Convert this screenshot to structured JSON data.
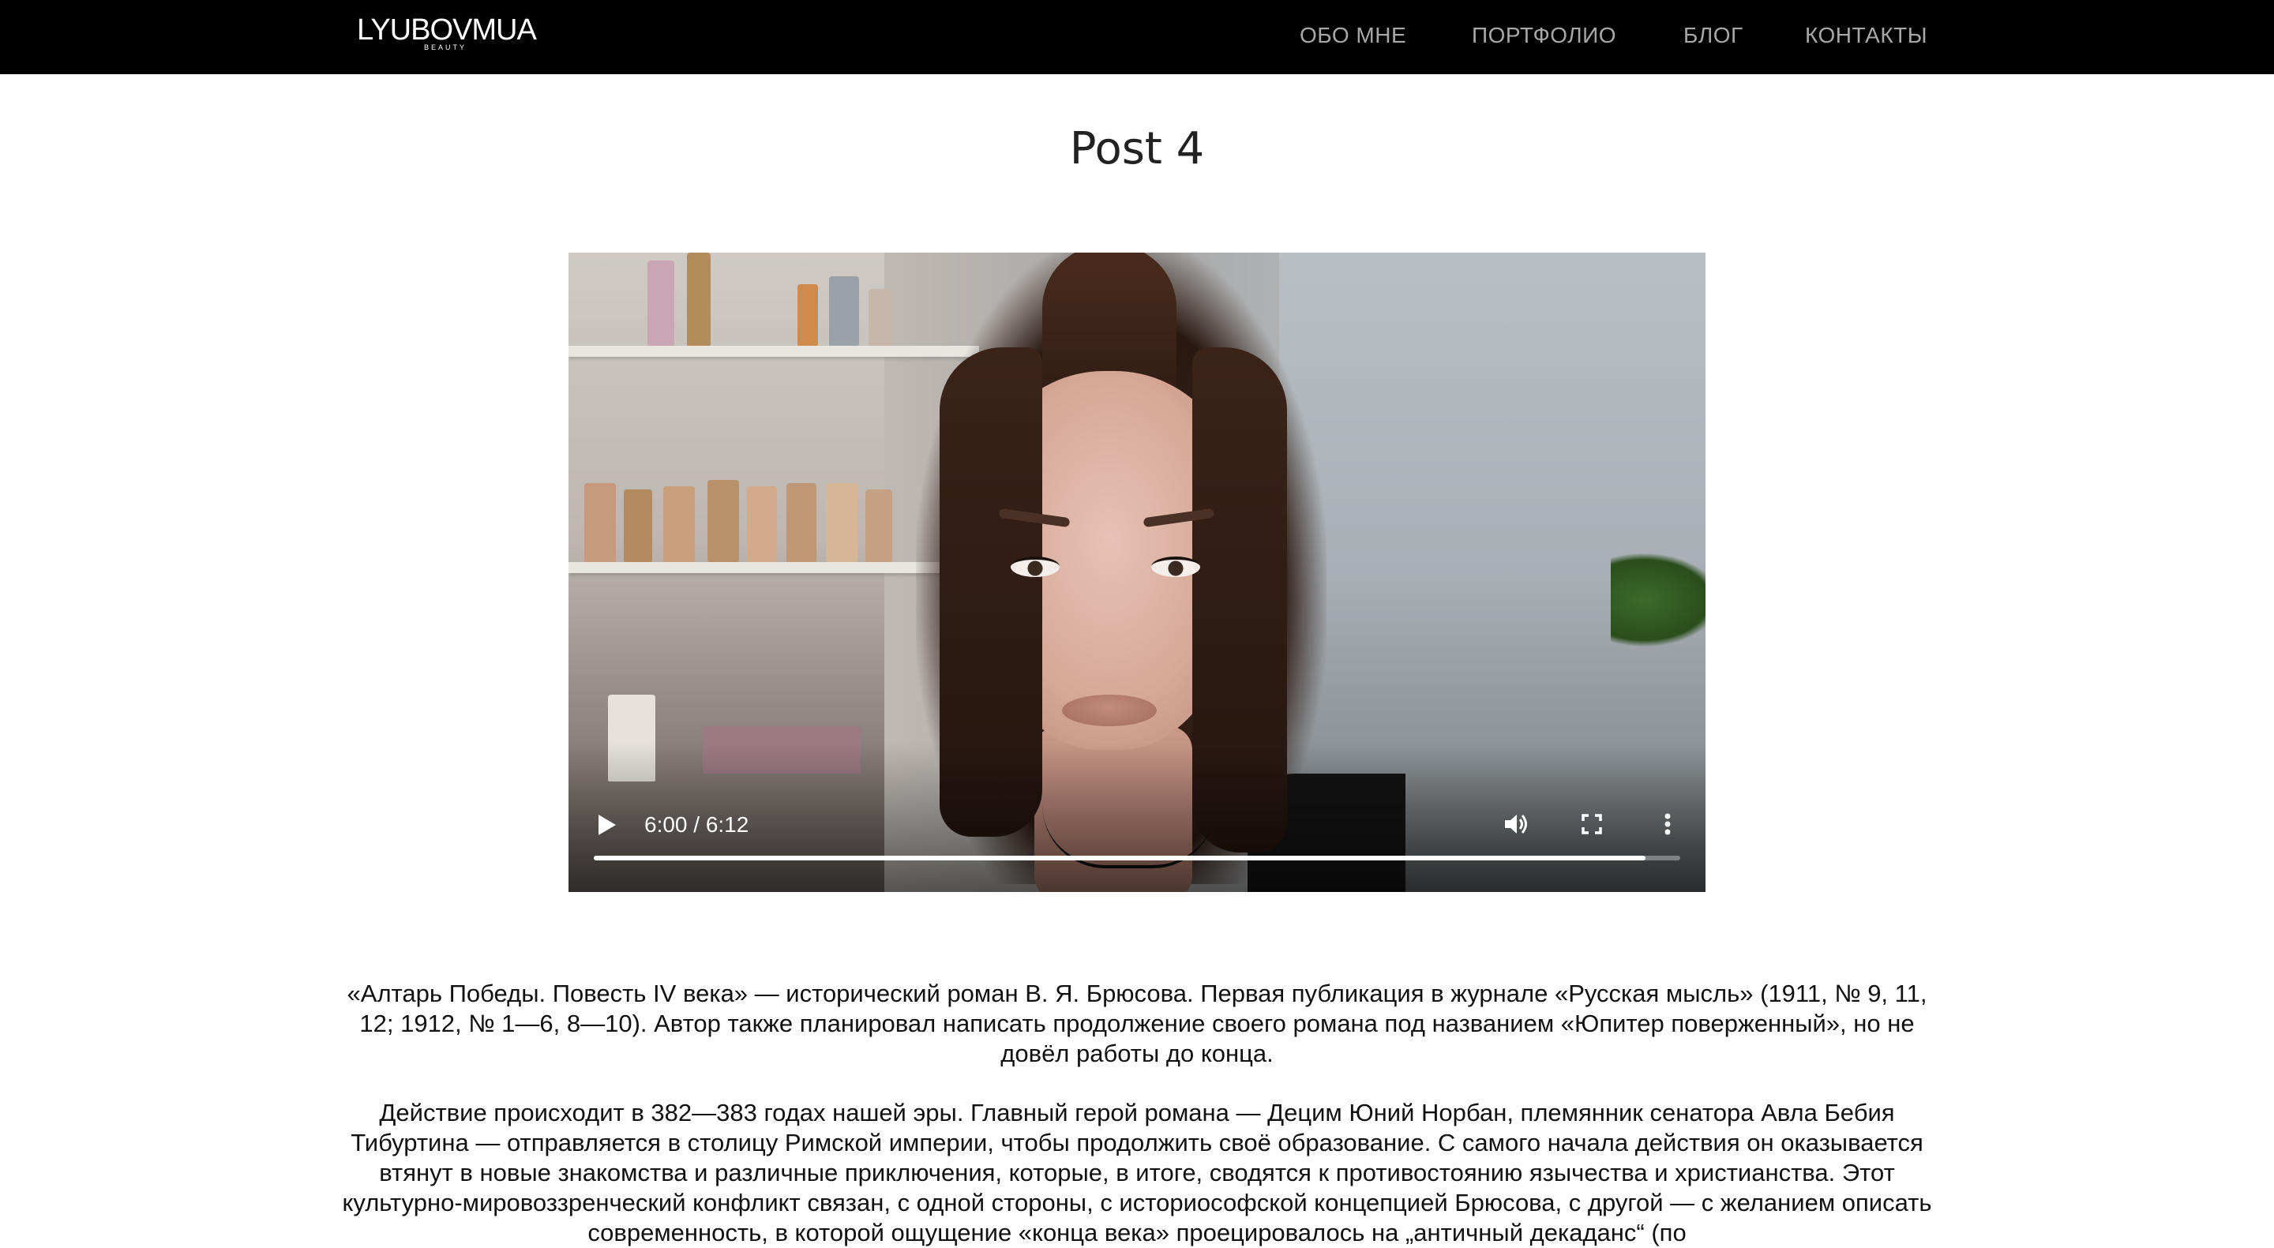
{
  "header": {
    "logo": {
      "main": "LYUBOVMUA",
      "sub": "BEAUTY"
    },
    "nav": [
      {
        "label": "ОБО МНЕ"
      },
      {
        "label": "ПОРТФОЛИО"
      },
      {
        "label": "БЛОГ"
      },
      {
        "label": "КОНТАКТЫ"
      }
    ]
  },
  "post": {
    "title": "Post 4"
  },
  "video": {
    "time": "6:00 / 6:12",
    "progress_fraction": 0.968,
    "icons": [
      "play-icon",
      "volume-icon",
      "fullscreen-icon",
      "more-options-icon"
    ]
  },
  "article": {
    "paragraphs": [
      "«Алтарь Победы. Повесть IV века» — исторический роман В. Я. Брюсова. Первая публикация в журнале «Русская мысль» (1911, № 9, 11, 12; 1912, № 1—6, 8—10). Автор также планировал написать продолжение своего романа под названием «Юпитер поверженный», но не довёл работы до конца.",
      "Действие происходит в 382—383 годах нашей эры. Главный герой романа — Децим Юний Норбан, племянник сенатора Авла Бебия Тибуртина — отправляется в столицу Римской империи, чтобы продолжить своё образование. С самого начала действия он оказывается втянут в новые знакомства и различные приключения, которые, в итоге, сводятся к противостоянию язычества и христианства. Этот культурно-мировоззренческий конфликт связан, с одной стороны, с историософской концепцией Брюсова, с другой — с желанием описать современность, в которой ощущение «конца века» проецировалось на „античный декаданс“ (по"
    ]
  },
  "colors": {
    "header_bg": "#000000",
    "nav_text": "#a8a8a8",
    "page_bg": "#ffffff",
    "text": "#111111"
  }
}
